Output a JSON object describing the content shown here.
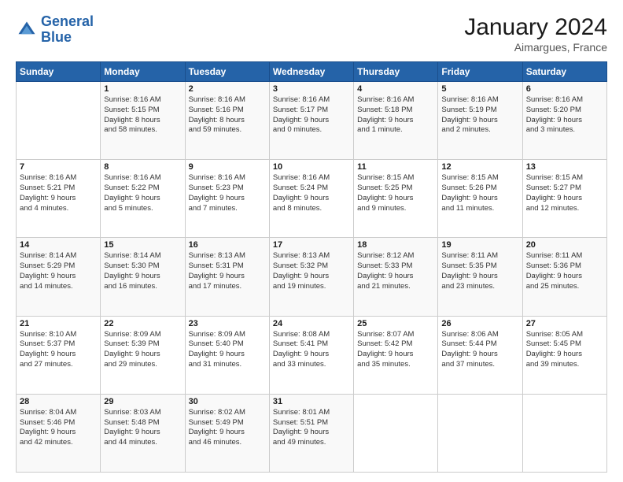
{
  "header": {
    "logo_line1": "General",
    "logo_line2": "Blue",
    "month_year": "January 2024",
    "location": "Aimargues, France"
  },
  "days_of_week": [
    "Sunday",
    "Monday",
    "Tuesday",
    "Wednesday",
    "Thursday",
    "Friday",
    "Saturday"
  ],
  "weeks": [
    [
      {
        "day": "",
        "info": ""
      },
      {
        "day": "1",
        "info": "Sunrise: 8:16 AM\nSunset: 5:15 PM\nDaylight: 8 hours\nand 58 minutes."
      },
      {
        "day": "2",
        "info": "Sunrise: 8:16 AM\nSunset: 5:16 PM\nDaylight: 8 hours\nand 59 minutes."
      },
      {
        "day": "3",
        "info": "Sunrise: 8:16 AM\nSunset: 5:17 PM\nDaylight: 9 hours\nand 0 minutes."
      },
      {
        "day": "4",
        "info": "Sunrise: 8:16 AM\nSunset: 5:18 PM\nDaylight: 9 hours\nand 1 minute."
      },
      {
        "day": "5",
        "info": "Sunrise: 8:16 AM\nSunset: 5:19 PM\nDaylight: 9 hours\nand 2 minutes."
      },
      {
        "day": "6",
        "info": "Sunrise: 8:16 AM\nSunset: 5:20 PM\nDaylight: 9 hours\nand 3 minutes."
      }
    ],
    [
      {
        "day": "7",
        "info": "Sunrise: 8:16 AM\nSunset: 5:21 PM\nDaylight: 9 hours\nand 4 minutes."
      },
      {
        "day": "8",
        "info": "Sunrise: 8:16 AM\nSunset: 5:22 PM\nDaylight: 9 hours\nand 5 minutes."
      },
      {
        "day": "9",
        "info": "Sunrise: 8:16 AM\nSunset: 5:23 PM\nDaylight: 9 hours\nand 7 minutes."
      },
      {
        "day": "10",
        "info": "Sunrise: 8:16 AM\nSunset: 5:24 PM\nDaylight: 9 hours\nand 8 minutes."
      },
      {
        "day": "11",
        "info": "Sunrise: 8:15 AM\nSunset: 5:25 PM\nDaylight: 9 hours\nand 9 minutes."
      },
      {
        "day": "12",
        "info": "Sunrise: 8:15 AM\nSunset: 5:26 PM\nDaylight: 9 hours\nand 11 minutes."
      },
      {
        "day": "13",
        "info": "Sunrise: 8:15 AM\nSunset: 5:27 PM\nDaylight: 9 hours\nand 12 minutes."
      }
    ],
    [
      {
        "day": "14",
        "info": "Sunrise: 8:14 AM\nSunset: 5:29 PM\nDaylight: 9 hours\nand 14 minutes."
      },
      {
        "day": "15",
        "info": "Sunrise: 8:14 AM\nSunset: 5:30 PM\nDaylight: 9 hours\nand 16 minutes."
      },
      {
        "day": "16",
        "info": "Sunrise: 8:13 AM\nSunset: 5:31 PM\nDaylight: 9 hours\nand 17 minutes."
      },
      {
        "day": "17",
        "info": "Sunrise: 8:13 AM\nSunset: 5:32 PM\nDaylight: 9 hours\nand 19 minutes."
      },
      {
        "day": "18",
        "info": "Sunrise: 8:12 AM\nSunset: 5:33 PM\nDaylight: 9 hours\nand 21 minutes."
      },
      {
        "day": "19",
        "info": "Sunrise: 8:11 AM\nSunset: 5:35 PM\nDaylight: 9 hours\nand 23 minutes."
      },
      {
        "day": "20",
        "info": "Sunrise: 8:11 AM\nSunset: 5:36 PM\nDaylight: 9 hours\nand 25 minutes."
      }
    ],
    [
      {
        "day": "21",
        "info": "Sunrise: 8:10 AM\nSunset: 5:37 PM\nDaylight: 9 hours\nand 27 minutes."
      },
      {
        "day": "22",
        "info": "Sunrise: 8:09 AM\nSunset: 5:39 PM\nDaylight: 9 hours\nand 29 minutes."
      },
      {
        "day": "23",
        "info": "Sunrise: 8:09 AM\nSunset: 5:40 PM\nDaylight: 9 hours\nand 31 minutes."
      },
      {
        "day": "24",
        "info": "Sunrise: 8:08 AM\nSunset: 5:41 PM\nDaylight: 9 hours\nand 33 minutes."
      },
      {
        "day": "25",
        "info": "Sunrise: 8:07 AM\nSunset: 5:42 PM\nDaylight: 9 hours\nand 35 minutes."
      },
      {
        "day": "26",
        "info": "Sunrise: 8:06 AM\nSunset: 5:44 PM\nDaylight: 9 hours\nand 37 minutes."
      },
      {
        "day": "27",
        "info": "Sunrise: 8:05 AM\nSunset: 5:45 PM\nDaylight: 9 hours\nand 39 minutes."
      }
    ],
    [
      {
        "day": "28",
        "info": "Sunrise: 8:04 AM\nSunset: 5:46 PM\nDaylight: 9 hours\nand 42 minutes."
      },
      {
        "day": "29",
        "info": "Sunrise: 8:03 AM\nSunset: 5:48 PM\nDaylight: 9 hours\nand 44 minutes."
      },
      {
        "day": "30",
        "info": "Sunrise: 8:02 AM\nSunset: 5:49 PM\nDaylight: 9 hours\nand 46 minutes."
      },
      {
        "day": "31",
        "info": "Sunrise: 8:01 AM\nSunset: 5:51 PM\nDaylight: 9 hours\nand 49 minutes."
      },
      {
        "day": "",
        "info": ""
      },
      {
        "day": "",
        "info": ""
      },
      {
        "day": "",
        "info": ""
      }
    ]
  ]
}
